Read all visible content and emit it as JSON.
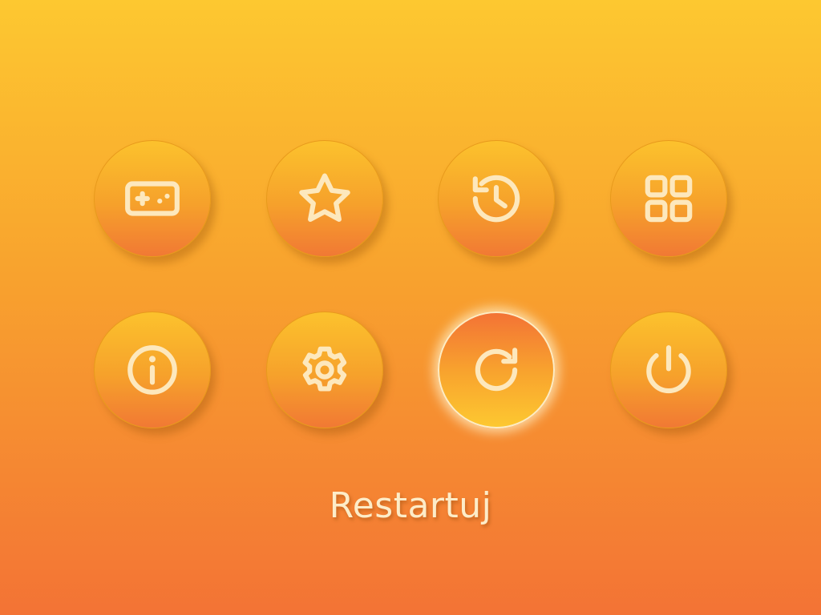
{
  "menu": {
    "items": [
      {
        "id": "games",
        "icon": "gamepad-icon",
        "selected": false
      },
      {
        "id": "favorites",
        "icon": "star-icon",
        "selected": false
      },
      {
        "id": "history",
        "icon": "history-icon",
        "selected": false
      },
      {
        "id": "apps",
        "icon": "grid-icon",
        "selected": false
      },
      {
        "id": "info",
        "icon": "info-icon",
        "selected": false
      },
      {
        "id": "settings",
        "icon": "gear-icon",
        "selected": false
      },
      {
        "id": "restart",
        "icon": "restart-icon",
        "selected": true
      },
      {
        "id": "power",
        "icon": "power-icon",
        "selected": false
      }
    ]
  },
  "caption": {
    "text": "Restartuj"
  },
  "colors": {
    "background_top": "#fdc830",
    "background_bottom": "#f37335",
    "icon_stroke": "#fde8bd",
    "selected_glow": "#fff0c8"
  }
}
